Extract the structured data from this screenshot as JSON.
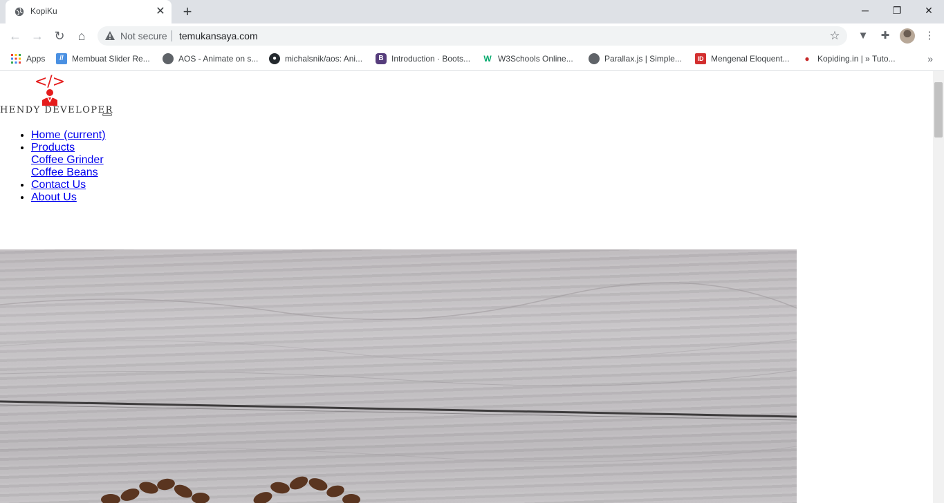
{
  "browser": {
    "tab_title": "KopiKu",
    "new_tab": "+",
    "omnibox": {
      "security_label": "Not secure",
      "url": "temukansaya.com"
    },
    "bookmarks": [
      {
        "label": "Apps",
        "icon": "apps-grid-icon",
        "color": "#4285f4"
      },
      {
        "label": "Membuat Slider Re...",
        "icon": "slider-icon",
        "color": "#4a90e2"
      },
      {
        "label": "AOS - Animate on s...",
        "icon": "globe-icon",
        "color": "#5f6368"
      },
      {
        "label": "michalsnik/aos: Ani...",
        "icon": "github-icon",
        "color": "#24292e"
      },
      {
        "label": "Introduction · Boots...",
        "icon": "bootstrap-icon",
        "color": "#563d7c"
      },
      {
        "label": "W3Schools Online...",
        "icon": "w3schools-icon",
        "color": "#04aa6d"
      },
      {
        "label": "Parallax.js | Simple...",
        "icon": "globe-icon",
        "color": "#5f6368"
      },
      {
        "label": "Mengenal Eloquent...",
        "icon": "id-icon",
        "color": "#d32f2f"
      },
      {
        "label": "Kopiding.in | » Tuto...",
        "icon": "kopiding-icon",
        "color": "#c62828"
      }
    ]
  },
  "page": {
    "logo": {
      "glyph": "</>",
      "text": "HENDY DEVELOPER",
      "accent": "#e51c1c"
    },
    "nav": {
      "home": "Home (current)",
      "products": "Products",
      "coffee_grinder": "Coffee Grinder",
      "coffee_beans": "Coffee Beans",
      "contact": "Contact Us",
      "about": "About Us"
    }
  }
}
